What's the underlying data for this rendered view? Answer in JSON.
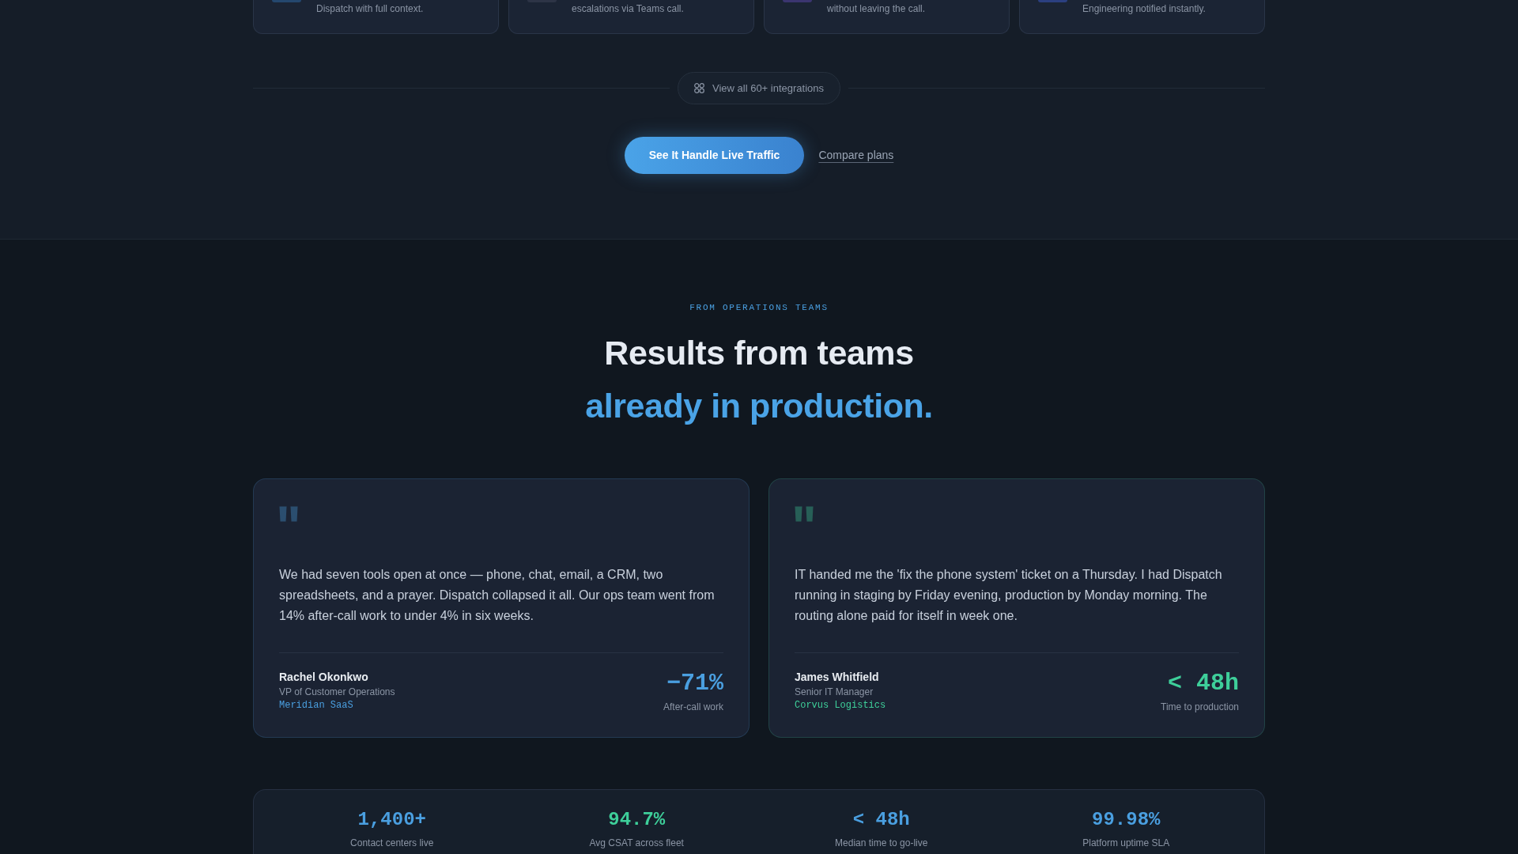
{
  "integration_cards": [
    {
      "description": "Dispatch with full context.",
      "color": "#24476e"
    },
    {
      "description": "escalations via Teams call.",
      "color": "#2d3446"
    },
    {
      "description": "without leaving the call.",
      "color": "#3b3570"
    },
    {
      "description": "Engineering notified instantly.",
      "color": "#2b3f80"
    }
  ],
  "integrations_link": {
    "label": "View all 60+ integrations"
  },
  "cta": {
    "primary": "See It Handle Live Traffic",
    "secondary": "Compare plans"
  },
  "testimonials_section": {
    "eyebrow": "FROM OPERATIONS TEAMS",
    "heading": "Results from teams",
    "heading_accent": "already in production.",
    "testimonials": [
      {
        "quote": "We had seven tools open at once — phone, chat, email, a CRM, two spreadsheets, and a prayer. Dispatch collapsed it all. Our ops team went from 14% after-call work to under 4% in six weeks.",
        "name": "Rachel Okonkwo",
        "role": "VP of Customer Operations",
        "company": "Meridian SaaS",
        "metric": "−71%",
        "metric_label": "After-call work",
        "color": "#4a9fe0"
      },
      {
        "quote": "IT handed me the 'fix the phone system' ticket on a Thursday. I had Dispatch running in staging by Friday evening, production by Monday morning. The routing alone paid for itself in week one.",
        "name": "James Whitfield",
        "role": "Senior IT Manager",
        "company": "Corvus Logistics",
        "metric": "< 48h",
        "metric_label": "Time to production",
        "color": "#3ecf9a"
      }
    ]
  },
  "stats": [
    {
      "value": "1,400+",
      "label": "Contact centers live",
      "color": "#4a9fe0"
    },
    {
      "value": "94.7%",
      "label": "Avg CSAT across fleet",
      "color": "#3ecf9a"
    },
    {
      "value": "< 48h",
      "label": "Median time to go-live",
      "color": "#4a9fe0"
    },
    {
      "value": "99.98%",
      "label": "Platform uptime SLA",
      "color": "#4a9fe0"
    }
  ]
}
